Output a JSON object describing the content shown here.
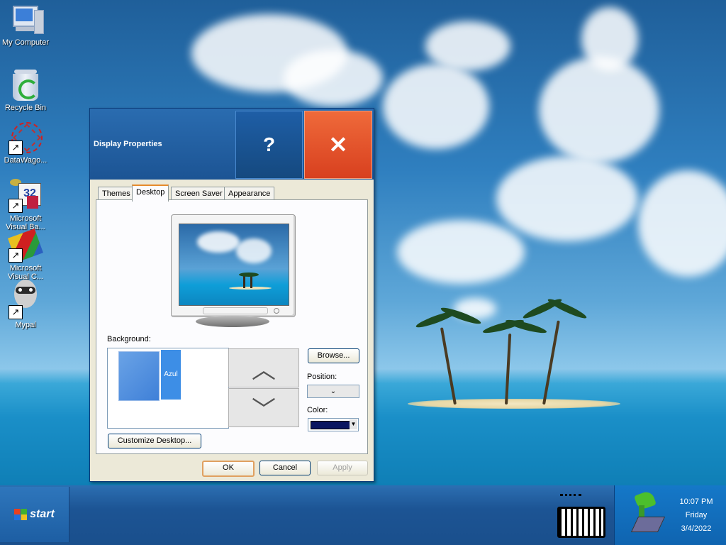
{
  "desktop": {
    "icons": [
      {
        "label": "My Computer"
      },
      {
        "label": "Recycle Bin"
      },
      {
        "label": "DataWago..."
      },
      {
        "label": "Microsoft Visual Ba..."
      },
      {
        "label": "Microsoft Visual C..."
      },
      {
        "label": "Mypal"
      }
    ]
  },
  "dialog": {
    "title": "Display Properties",
    "help_symbol": "?",
    "close_symbol": "✕",
    "tabs": [
      {
        "label": "Themes"
      },
      {
        "label": "Desktop"
      },
      {
        "label": "Screen Saver"
      },
      {
        "label": "Appearance"
      }
    ],
    "active_tab": "Desktop",
    "background_label": "Background:",
    "background_items": [
      {
        "label": "Azul"
      }
    ],
    "browse_label": "Browse...",
    "position_label": "Position:",
    "position_value": "⌄",
    "color_label": "Color:",
    "color_value": "#0a1560",
    "customize_label": "Customize Desktop...",
    "ok_label": "OK",
    "cancel_label": "Cancel",
    "apply_label": "Apply"
  },
  "taskbar": {
    "start_label": "start",
    "clock": {
      "time": "10:07 PM",
      "day": "Friday",
      "date": "3/4/2022"
    }
  },
  "colors": {
    "titlebar": "#1c5494",
    "close": "#d8401f",
    "accent_tab": "#e68b2c"
  }
}
